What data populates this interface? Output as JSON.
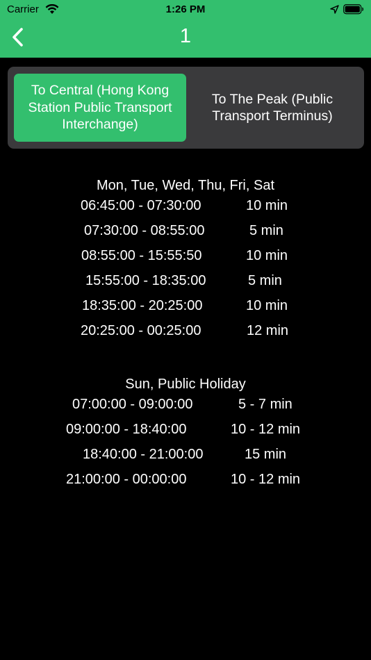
{
  "status_bar": {
    "carrier": "Carrier",
    "time": "1:26 PM",
    "wifi_icon": "wifi-icon",
    "location_icon": "location-arrow-icon",
    "battery_icon": "battery-icon"
  },
  "nav": {
    "title": "1",
    "back_icon": "chevron-left-icon"
  },
  "colors": {
    "accent": "#33bf6e",
    "segment_bg": "#3a3a3c",
    "background": "#000000"
  },
  "segment": {
    "selected_index": 0,
    "options": [
      "To Central (Hong Kong Station Public Transport Interchange)",
      "To The Peak (Public Transport Terminus)"
    ]
  },
  "schedules": [
    {
      "days": "Mon, Tue, Wed, Thu, Fri, Sat",
      "rows": [
        {
          "time": "06:45:00 - 07:30:00",
          "freq": "10 min"
        },
        {
          "time": "07:30:00 - 08:55:00",
          "freq": "5 min"
        },
        {
          "time": "08:55:00 - 15:55:50",
          "freq": "10 min"
        },
        {
          "time": "15:55:00 - 18:35:00",
          "freq": "5 min"
        },
        {
          "time": "18:35:00 - 20:25:00",
          "freq": "10 min"
        },
        {
          "time": "20:25:00 - 00:25:00",
          "freq": "12 min"
        }
      ]
    },
    {
      "days": "Sun, Public Holiday",
      "rows": [
        {
          "time": "07:00:00 - 09:00:00",
          "freq": "5 - 7 min"
        },
        {
          "time": "09:00:00 - 18:40:00",
          "freq": "10 - 12 min"
        },
        {
          "time": "18:40:00 - 21:00:00",
          "freq": "15 min"
        },
        {
          "time": "21:00:00 - 00:00:00",
          "freq": "10 - 12 min"
        }
      ]
    }
  ]
}
